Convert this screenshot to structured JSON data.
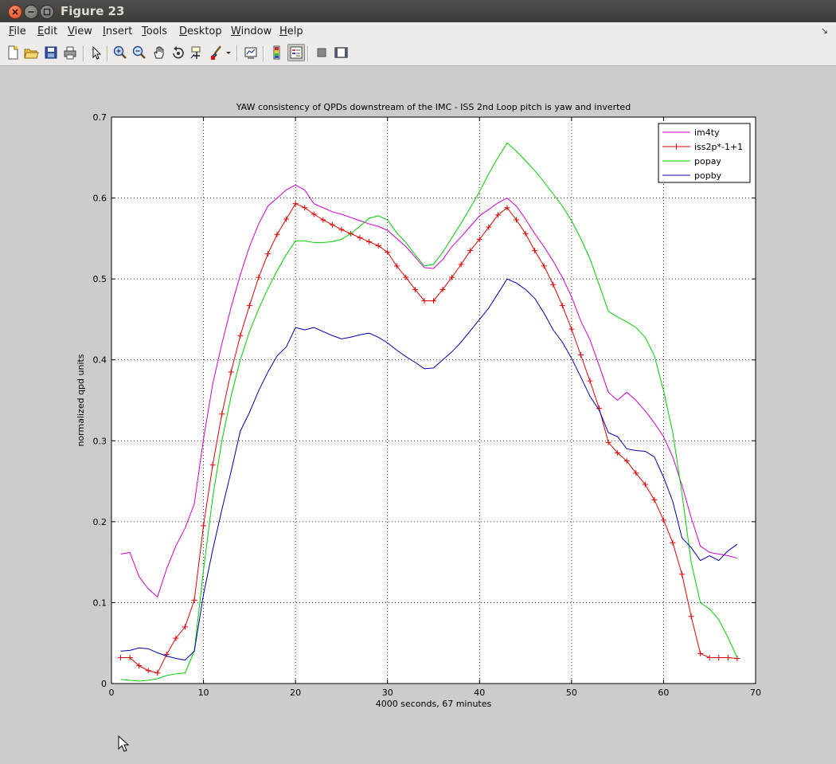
{
  "window": {
    "title": "Figure 23"
  },
  "menubar": [
    {
      "label": "File",
      "key": "F"
    },
    {
      "label": "Edit",
      "key": "E"
    },
    {
      "label": "View",
      "key": "V"
    },
    {
      "label": "Insert",
      "key": "I"
    },
    {
      "label": "Tools",
      "key": "T"
    },
    {
      "label": "Desktop",
      "key": "D"
    },
    {
      "label": "Window",
      "key": "W"
    },
    {
      "label": "Help",
      "key": "H"
    }
  ],
  "toolbar_icons": [
    "new-figure-icon",
    "open-file-icon",
    "save-icon",
    "print-icon",
    "edit-plot-icon",
    "zoom-in-icon",
    "zoom-out-icon",
    "pan-icon",
    "rotate-3d-icon",
    "data-cursor-icon",
    "brush-icon",
    "brush-dropdown-icon",
    "link-plot-icon",
    "colorbar-icon",
    "legend-icon",
    "hide-plot-tools-icon",
    "show-plot-tools-icon"
  ],
  "colors": {
    "im4ty": "#cc00cc",
    "iss2p": "#dd0000",
    "popay": "#00cc00",
    "popby": "#0000aa"
  },
  "chart_data": {
    "type": "line",
    "title": "YAW consistency of QPDs downstream of the IMC - ISS 2nd Loop pitch is yaw and inverted",
    "xlabel": "4000 seconds, 67 minutes",
    "ylabel": "normalized qpd units",
    "xlim": [
      0,
      70
    ],
    "ylim": [
      0,
      0.7
    ],
    "xticks": [
      0,
      10,
      20,
      30,
      40,
      50,
      60,
      70
    ],
    "yticks": [
      0,
      0.1,
      0.2,
      0.3,
      0.4,
      0.5,
      0.6,
      0.7
    ],
    "grid": true,
    "legend": "top-right",
    "x": [
      1,
      2,
      3,
      4,
      5,
      6,
      7,
      8,
      9,
      10,
      11,
      12,
      13,
      14,
      15,
      16,
      17,
      18,
      19,
      20,
      21,
      22,
      23,
      24,
      25,
      26,
      27,
      28,
      29,
      30,
      31,
      32,
      33,
      34,
      35,
      36,
      37,
      38,
      39,
      40,
      41,
      42,
      43,
      44,
      45,
      46,
      47,
      48,
      49,
      50,
      51,
      52,
      53,
      54,
      55,
      56,
      57,
      58,
      59,
      60,
      61,
      62,
      63,
      64,
      65,
      66,
      67,
      68
    ],
    "series": [
      {
        "name": "im4ty",
        "marker": "none",
        "values": [
          0.16,
          0.162,
          0.132,
          0.117,
          0.107,
          0.142,
          0.17,
          0.192,
          0.222,
          0.302,
          0.37,
          0.42,
          0.465,
          0.505,
          0.54,
          0.568,
          0.59,
          0.6,
          0.61,
          0.616,
          0.61,
          0.593,
          0.588,
          0.583,
          0.58,
          0.576,
          0.572,
          0.568,
          0.565,
          0.56,
          0.55,
          0.54,
          0.527,
          0.514,
          0.513,
          0.524,
          0.54,
          0.552,
          0.565,
          0.578,
          0.586,
          0.594,
          0.6,
          0.59,
          0.574,
          0.556,
          0.54,
          0.522,
          0.502,
          0.478,
          0.448,
          0.425,
          0.393,
          0.36,
          0.35,
          0.36,
          0.35,
          0.337,
          0.322,
          0.305,
          0.28,
          0.245,
          0.205,
          0.17,
          0.162,
          0.16,
          0.158,
          0.155
        ]
      },
      {
        "name": "iss2p*-1+1",
        "marker": "+",
        "values": [
          0.032,
          0.032,
          0.022,
          0.016,
          0.013,
          0.036,
          0.056,
          0.07,
          0.103,
          0.195,
          0.27,
          0.333,
          0.385,
          0.43,
          0.467,
          0.502,
          0.531,
          0.555,
          0.574,
          0.593,
          0.588,
          0.58,
          0.573,
          0.567,
          0.561,
          0.556,
          0.551,
          0.546,
          0.541,
          0.533,
          0.516,
          0.502,
          0.487,
          0.473,
          0.473,
          0.487,
          0.502,
          0.518,
          0.535,
          0.549,
          0.564,
          0.579,
          0.588,
          0.573,
          0.556,
          0.535,
          0.516,
          0.493,
          0.467,
          0.438,
          0.406,
          0.374,
          0.34,
          0.298,
          0.285,
          0.275,
          0.26,
          0.246,
          0.227,
          0.202,
          0.174,
          0.135,
          0.083,
          0.037,
          0.032,
          0.032,
          0.032,
          0.031
        ]
      },
      {
        "name": "popay",
        "marker": "none",
        "values": [
          0.005,
          0.004,
          0.003,
          0.004,
          0.006,
          0.01,
          0.012,
          0.013,
          0.04,
          0.14,
          0.23,
          0.3,
          0.355,
          0.4,
          0.435,
          0.463,
          0.488,
          0.51,
          0.53,
          0.547,
          0.547,
          0.545,
          0.545,
          0.546,
          0.549,
          0.556,
          0.565,
          0.575,
          0.578,
          0.573,
          0.557,
          0.545,
          0.53,
          0.516,
          0.518,
          0.533,
          0.551,
          0.569,
          0.588,
          0.608,
          0.63,
          0.65,
          0.668,
          0.658,
          0.646,
          0.634,
          0.62,
          0.605,
          0.59,
          0.572,
          0.55,
          0.525,
          0.493,
          0.46,
          0.453,
          0.447,
          0.44,
          0.428,
          0.405,
          0.362,
          0.31,
          0.235,
          0.15,
          0.1,
          0.092,
          0.079,
          0.057,
          0.032
        ]
      },
      {
        "name": "popby",
        "marker": "none",
        "values": [
          0.04,
          0.041,
          0.044,
          0.043,
          0.038,
          0.034,
          0.031,
          0.029,
          0.04,
          0.11,
          0.165,
          0.215,
          0.262,
          0.312,
          0.335,
          0.362,
          0.385,
          0.405,
          0.416,
          0.44,
          0.437,
          0.44,
          0.435,
          0.43,
          0.426,
          0.428,
          0.431,
          0.433,
          0.428,
          0.421,
          0.412,
          0.404,
          0.397,
          0.389,
          0.39,
          0.4,
          0.41,
          0.422,
          0.436,
          0.45,
          0.464,
          0.482,
          0.5,
          0.495,
          0.487,
          0.476,
          0.458,
          0.437,
          0.422,
          0.402,
          0.379,
          0.355,
          0.338,
          0.31,
          0.305,
          0.29,
          0.288,
          0.287,
          0.28,
          0.255,
          0.225,
          0.18,
          0.168,
          0.152,
          0.158,
          0.152,
          0.164,
          0.172
        ]
      }
    ]
  }
}
